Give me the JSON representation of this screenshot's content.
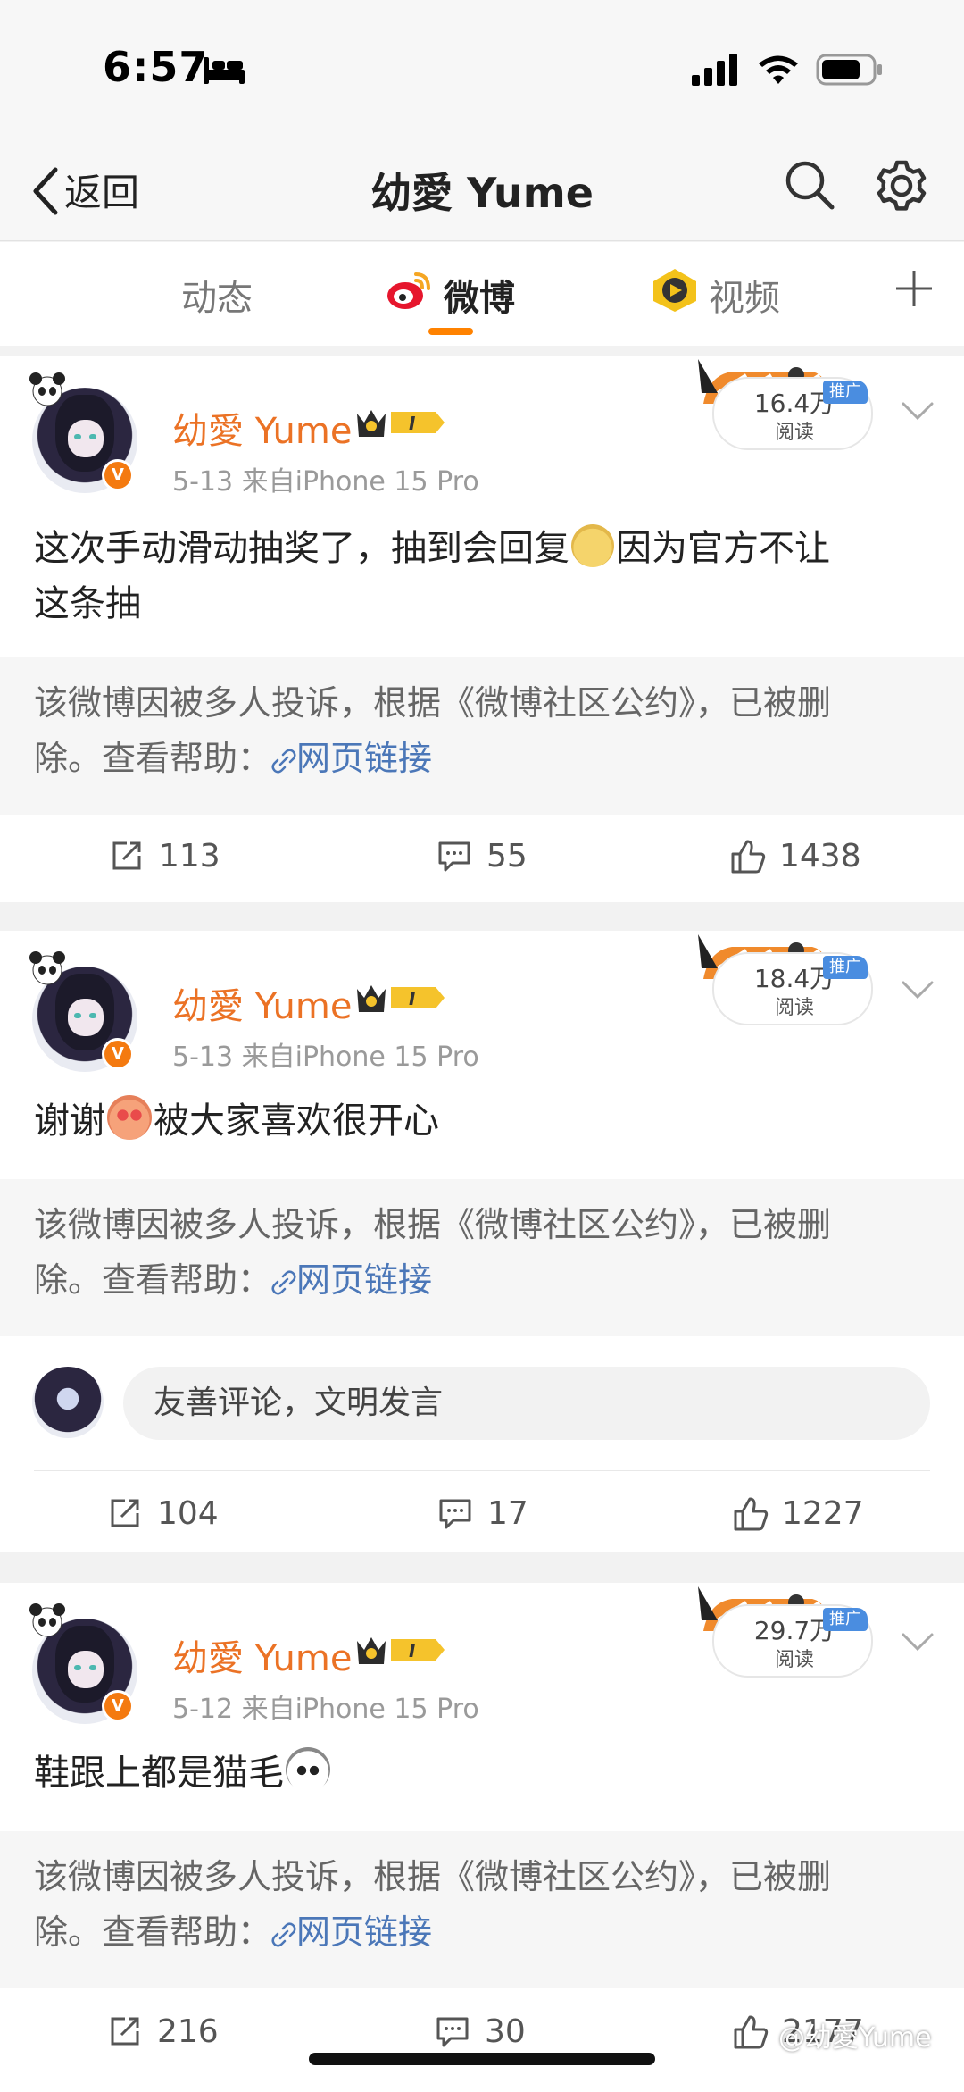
{
  "status_bar": {
    "time": "6:57"
  },
  "nav": {
    "back_label": "返回",
    "title": "幼愛 Yume"
  },
  "tabs": [
    {
      "label": "动态",
      "active": false
    },
    {
      "label": "微博",
      "active": true
    },
    {
      "label": "视频",
      "active": false
    }
  ],
  "posts": [
    {
      "author": "幼愛 Yume",
      "meta": "5-13  来自iPhone 15 Pro",
      "reads": "16.4万",
      "reads_label": "阅读",
      "promo": "推广",
      "text_line1": "这次手动滑动抽奖了，抽到会回复",
      "text_line1b": "因为官方不让",
      "text_line2": "这条抽",
      "deleted_line1": "该微博因被多人投诉，根据《微博社区公约》，已被删",
      "deleted_line2": "除。查看帮助：",
      "link": "网页链接",
      "reposts": "113",
      "comments": "55",
      "likes": "1438"
    },
    {
      "author": "幼愛 Yume",
      "meta": "5-13  来自iPhone 15 Pro",
      "reads": "18.4万",
      "reads_label": "阅读",
      "promo": "推广",
      "text_a": "谢谢",
      "text_b": "被大家喜欢很开心",
      "deleted_line1": "该微博因被多人投诉，根据《微博社区公约》，已被删",
      "deleted_line2": "除。查看帮助：",
      "link": "网页链接",
      "comment_placeholder": "友善评论，文明发言",
      "reposts": "104",
      "comments": "17",
      "likes": "1227"
    },
    {
      "author": "幼愛 Yume",
      "meta": "5-12  来自iPhone 15 Pro",
      "reads": "29.7万",
      "reads_label": "阅读",
      "promo": "推广",
      "text_a": "鞋跟上都是猫毛",
      "deleted_line1": "该微博因被多人投诉，根据《微博社区公约》，已被删",
      "deleted_line2": "除。查看帮助：",
      "link": "网页链接",
      "reposts": "216",
      "comments": "30",
      "likes": "2177"
    }
  ],
  "watermark": "@幼愛Yume",
  "colors": {
    "accent": "#eb7225",
    "link": "#4b77b8",
    "promo": "#4a8de0"
  }
}
